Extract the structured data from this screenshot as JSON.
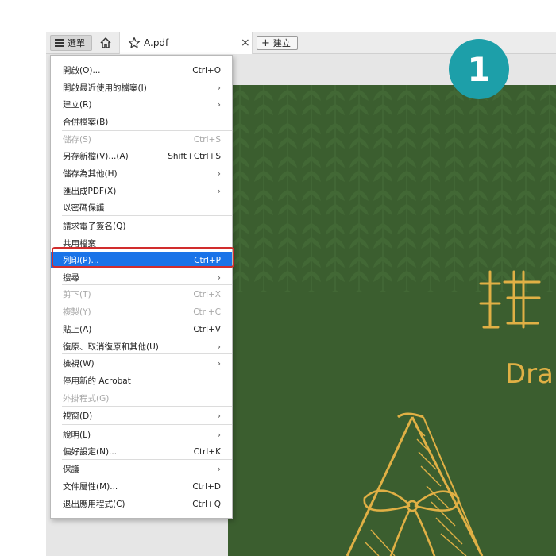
{
  "toolbar": {
    "menu_label": "選單",
    "tab_title": "A.pdf",
    "close_glyph": "×",
    "new_label": "建立",
    "new_plus_glyph": "+"
  },
  "step_badge": "1",
  "pdf_page": {
    "title_fragment": "Dra",
    "background_color": "#3b5e2f",
    "accent_color": "#e0b045"
  },
  "menu": {
    "items": [
      {
        "label": "開啟(O)...",
        "shortcut": "Ctrl+O",
        "submenu": false,
        "disabled": false
      },
      {
        "label": "開啟最近使用的檔案(I)",
        "shortcut": "",
        "submenu": true,
        "disabled": false
      },
      {
        "label": "建立(R)",
        "shortcut": "",
        "submenu": true,
        "disabled": false
      },
      {
        "label": "合併檔案(B)",
        "shortcut": "",
        "submenu": false,
        "disabled": false
      },
      {
        "label": "儲存(S)",
        "shortcut": "Ctrl+S",
        "submenu": false,
        "disabled": true
      },
      {
        "label": "另存新檔(V)...(A)",
        "shortcut": "Shift+Ctrl+S",
        "submenu": false,
        "disabled": false
      },
      {
        "label": "儲存為其他(H)",
        "shortcut": "",
        "submenu": true,
        "disabled": false
      },
      {
        "label": "匯出成PDF(X)",
        "shortcut": "",
        "submenu": true,
        "disabled": false
      },
      {
        "label": "以密碼保護",
        "shortcut": "",
        "submenu": false,
        "disabled": false
      },
      {
        "label": "請求電子簽名(Q)",
        "shortcut": "",
        "submenu": false,
        "disabled": false
      },
      {
        "label": "共用檔案",
        "shortcut": "",
        "submenu": false,
        "disabled": false
      },
      {
        "label": "列印(P)...",
        "shortcut": "Ctrl+P",
        "submenu": false,
        "disabled": false,
        "highlight": true
      },
      {
        "label": "搜尋",
        "shortcut": "",
        "submenu": true,
        "disabled": false
      },
      {
        "label": "剪下(T)",
        "shortcut": "Ctrl+X",
        "submenu": false,
        "disabled": true
      },
      {
        "label": "複製(Y)",
        "shortcut": "Ctrl+C",
        "submenu": false,
        "disabled": true
      },
      {
        "label": "貼上(A)",
        "shortcut": "Ctrl+V",
        "submenu": false,
        "disabled": false
      },
      {
        "label": "復原、取消復原和其他(U)",
        "shortcut": "",
        "submenu": true,
        "disabled": false
      },
      {
        "label": "檢視(W)",
        "shortcut": "",
        "submenu": true,
        "disabled": false
      },
      {
        "label": "停用新的 Acrobat",
        "shortcut": "",
        "submenu": false,
        "disabled": false
      },
      {
        "label": "外掛程式(G)",
        "shortcut": "",
        "submenu": false,
        "disabled": true
      },
      {
        "label": "視窗(D)",
        "shortcut": "",
        "submenu": true,
        "disabled": false
      },
      {
        "label": "說明(L)",
        "shortcut": "",
        "submenu": true,
        "disabled": false
      },
      {
        "label": "偏好設定(N)...",
        "shortcut": "Ctrl+K",
        "submenu": false,
        "disabled": false
      },
      {
        "label": "保護",
        "shortcut": "",
        "submenu": true,
        "disabled": false
      },
      {
        "label": "文件屬性(M)...",
        "shortcut": "Ctrl+D",
        "submenu": false,
        "disabled": false
      },
      {
        "label": "退出應用程式(C)",
        "shortcut": "Ctrl+Q",
        "submenu": false,
        "disabled": false
      }
    ],
    "submenu_arrow": "›"
  }
}
